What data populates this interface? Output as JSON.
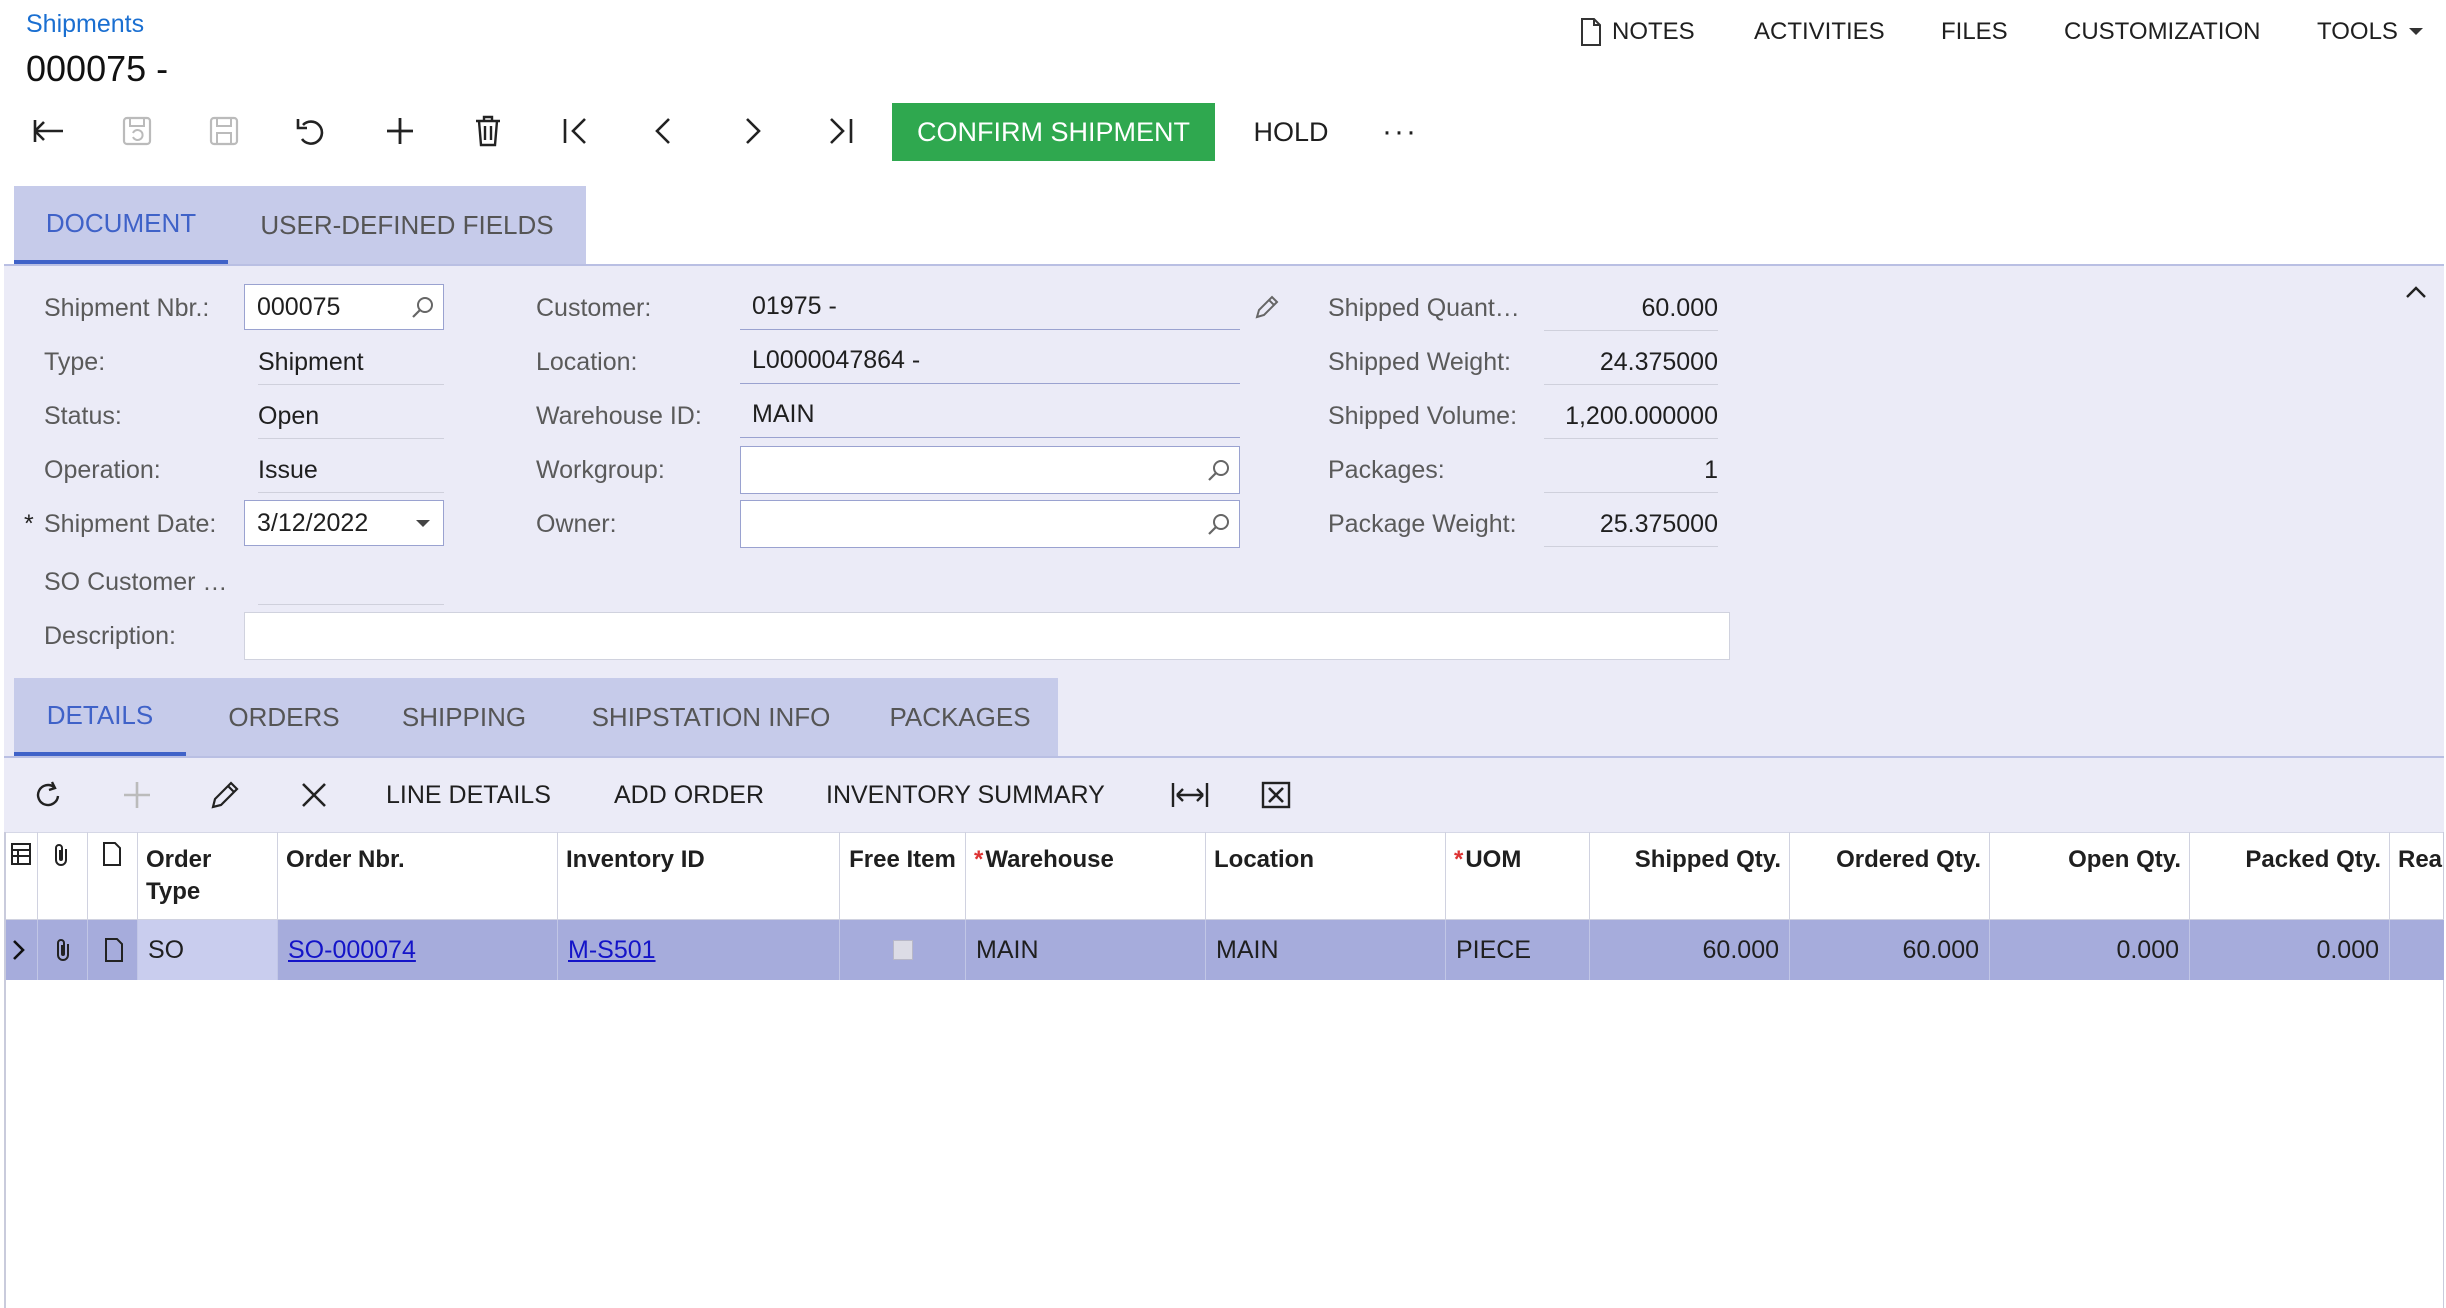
{
  "header": {
    "breadcrumb": "Shipments",
    "title": "000075 -",
    "menu": {
      "notes": "NOTES",
      "activities": "ACTIVITIES",
      "files": "FILES",
      "customization": "CUSTOMIZATION",
      "tools": "TOOLS"
    }
  },
  "toolbar": {
    "confirm": "CONFIRM SHIPMENT",
    "hold": "HOLD",
    "more": "···"
  },
  "top_tabs": [
    "DOCUMENT",
    "USER-DEFINED FIELDS"
  ],
  "form": {
    "shipment_nbr": {
      "label": "Shipment Nbr.:",
      "value": "000075"
    },
    "type": {
      "label": "Type:",
      "value": "Shipment"
    },
    "status": {
      "label": "Status:",
      "value": "Open"
    },
    "operation": {
      "label": "Operation:",
      "value": "Issue"
    },
    "shipment_date": {
      "label": "Shipment Date:",
      "value": "3/12/2022",
      "required_mark": "*"
    },
    "so_customer": {
      "label": "SO Customer …",
      "value": ""
    },
    "description": {
      "label": "Description:",
      "value": ""
    },
    "customer": {
      "label": "Customer:",
      "value": "01975 -"
    },
    "location": {
      "label": "Location:",
      "value": "L0000047864 -"
    },
    "warehouse": {
      "label": "Warehouse ID:",
      "value": "MAIN"
    },
    "workgroup": {
      "label": "Workgroup:",
      "value": ""
    },
    "owner": {
      "label": "Owner:",
      "value": ""
    },
    "shipped_quantity": {
      "label": "Shipped Quant…",
      "value": "60.000"
    },
    "shipped_weight": {
      "label": "Shipped Weight:",
      "value": "24.375000"
    },
    "shipped_volume": {
      "label": "Shipped Volume:",
      "value": "1,200.000000"
    },
    "packages": {
      "label": "Packages:",
      "value": "1"
    },
    "package_weight": {
      "label": "Package Weight:",
      "value": "25.375000"
    }
  },
  "bottom_tabs": [
    "DETAILS",
    "ORDERS",
    "SHIPPING",
    "SHIPSTATION INFO",
    "PACKAGES"
  ],
  "grid_toolbar": {
    "line_details": "LINE DETAILS",
    "add_order": "ADD ORDER",
    "inventory_summary": "INVENTORY SUMMARY"
  },
  "grid": {
    "headers": {
      "order_type": "Order Type",
      "order_nbr": "Order Nbr.",
      "inventory_id": "Inventory ID",
      "free_item": "Free Item",
      "warehouse": "Warehouse",
      "location": "Location",
      "uom": "UOM",
      "shipped_qty": "Shipped Qty.",
      "ordered_qty": "Ordered Qty.",
      "open_qty": "Open Qty.",
      "packed_qty": "Packed Qty.",
      "reason": "Rea"
    },
    "required_mark": "*",
    "row": {
      "order_type": "SO",
      "order_nbr": "SO-000074",
      "inventory_id": "M-S501",
      "free_item": false,
      "warehouse": "MAIN",
      "location": "MAIN",
      "uom": "PIECE",
      "shipped_qty": "60.000",
      "ordered_qty": "60.000",
      "open_qty": "0.000",
      "packed_qty": "0.000"
    }
  },
  "colors": {
    "accent": "#3f62c8",
    "confirm_green": "#2fa84f",
    "tab_bg": "#c6cbea",
    "panel_bg": "#ebebf7",
    "selected_row": "#a6acdc"
  }
}
